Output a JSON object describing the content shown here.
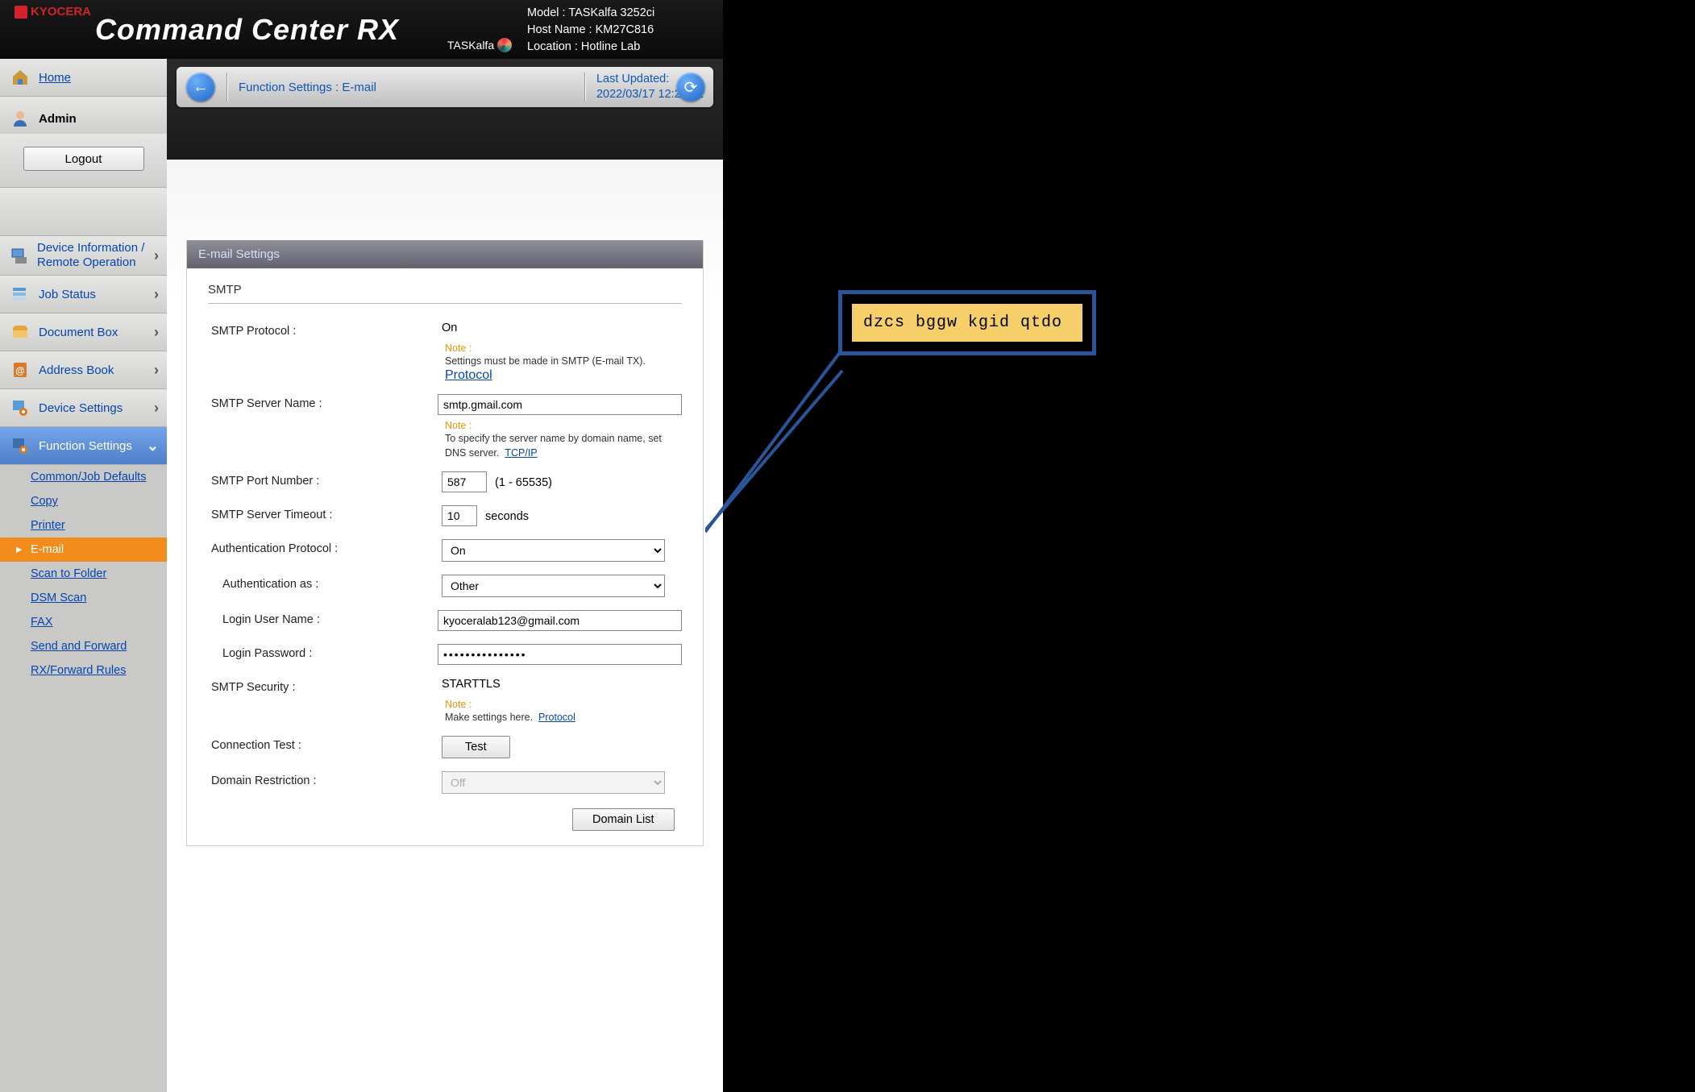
{
  "brand": {
    "vendor": "KYOCERA",
    "product": "Command Center RX",
    "subbrand": "TASKalfa"
  },
  "device": {
    "model_label": "Model :",
    "model": "TASKalfa 3252ci",
    "host_label": "Host Name :",
    "host": "KM27C816",
    "loc_label": "Location :",
    "loc": "Hotline Lab"
  },
  "sidebar": {
    "home": "Home",
    "user": "Admin",
    "logout": "Logout",
    "items": [
      {
        "label": "Device Information / Remote Operation"
      },
      {
        "label": "Job Status"
      },
      {
        "label": "Document Box"
      },
      {
        "label": "Address Book"
      },
      {
        "label": "Device Settings"
      },
      {
        "label": "Function Settings"
      }
    ],
    "sub": [
      "Common/Job Defaults",
      "Copy",
      "Printer",
      "E-mail",
      "Scan to Folder",
      "DSM Scan",
      "FAX",
      "Send and Forward",
      "RX/Forward Rules"
    ],
    "sub_selected": 3
  },
  "breadcrumb": {
    "text": "Function Settings : E-mail",
    "updated_label": "Last Updated:",
    "updated_value": "2022/03/17 12:28:01"
  },
  "section_title": "E-mail Settings",
  "group_title": "SMTP",
  "fields": {
    "protocol": {
      "label": "SMTP Protocol :",
      "value": "On"
    },
    "protocol_note": {
      "label": "Note :",
      "text": "Settings must be made in SMTP (E-mail TX).",
      "link": "Protocol"
    },
    "server": {
      "label": "SMTP Server Name :",
      "value": "smtp.gmail.com"
    },
    "server_note": {
      "label": "Note :",
      "text": "To specify the server name by domain name, set DNS server.",
      "link": "TCP/IP"
    },
    "port": {
      "label": "SMTP Port Number :",
      "value": "587",
      "suffix": "(1 - 65535)"
    },
    "timeout": {
      "label": "SMTP Server Timeout :",
      "value": "10",
      "suffix": "seconds"
    },
    "auth_proto": {
      "label": "Authentication Protocol :",
      "value": "On"
    },
    "auth_as": {
      "label": "Authentication as :",
      "value": "Other"
    },
    "login_user": {
      "label": "Login User Name :",
      "value": "kyoceralab123@gmail.com"
    },
    "login_pass": {
      "label": "Login Password :",
      "value": "•••••••••••••••"
    },
    "security": {
      "label": "SMTP Security :",
      "value": "STARTTLS"
    },
    "security_note": {
      "label": "Note :",
      "text": "Make settings here.",
      "link": "Protocol"
    },
    "conn_test": {
      "label": "Connection Test :",
      "button": "Test"
    },
    "domain_restrict": {
      "label": "Domain Restriction :",
      "value": "Off",
      "button": "Domain List"
    }
  },
  "callout": {
    "text": "dzcs bggw kgid qtdo"
  }
}
